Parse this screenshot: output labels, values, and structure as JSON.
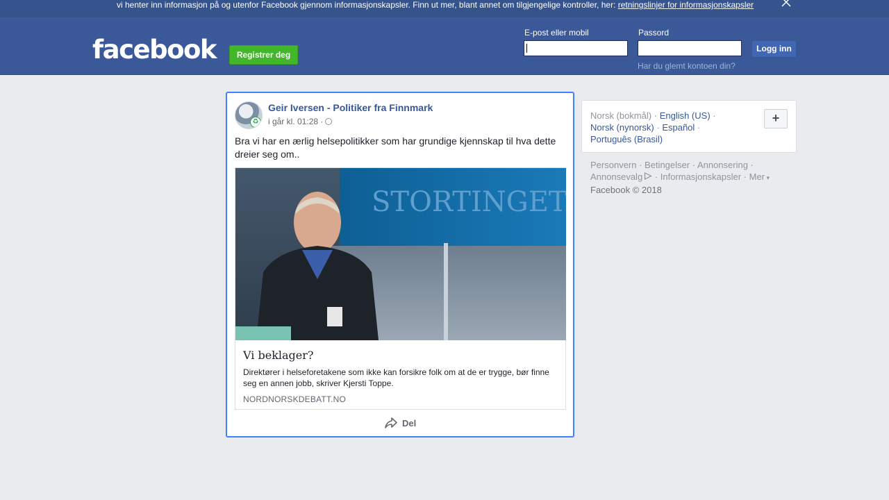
{
  "cookie_bar": {
    "text": "vi henter inn informasjon på og utenfor Facebook gjennom informasjonskapsler. Finn ut mer, blant annet om tilgjengelige kontroller, her: ",
    "link": "retningslinjer for informasjonskapsler"
  },
  "header": {
    "logo": "facebook",
    "register_label": "Registrer deg",
    "email_label": "E-post eller mobil",
    "email_value": "",
    "password_label": "Passord",
    "password_value": "",
    "login_label": "Logg inn",
    "forgot_label": "Har du glemt kontoen din?"
  },
  "post": {
    "author": "Geir Iversen - Politiker fra Finnmark",
    "timestamp": "i går kl. 01:28 ·",
    "text": "Bra vi har en ærlig helsepolitikker som har grundige kjennskap til hva dette dreier seg om..",
    "link": {
      "image_sign": "STORTINGET",
      "title": "Vi beklager?",
      "description": "Direktører i helseforetakene som ikke kan forsikre folk om at de er trygge, bør finne seg en annen jobb, skriver Kjersti Toppe.",
      "domain": "NORDNORSKDEBATT.NO"
    },
    "share_label": "Del"
  },
  "sidebar": {
    "languages": [
      {
        "label": "Norsk (bokmål)",
        "current": true
      },
      {
        "label": "English (US)",
        "current": false
      },
      {
        "label": "Norsk (nynorsk)",
        "current": false
      },
      {
        "label": "Español",
        "current": false
      },
      {
        "label": "Português (Brasil)",
        "current": false
      }
    ],
    "add_language_label": "+",
    "footer": {
      "links": [
        "Personvern",
        "Betingelser",
        "Annonsering",
        "Annonsevalg",
        "Informasjonskapsler",
        "Mer"
      ],
      "copyright": "Facebook © 2018"
    }
  },
  "colors": {
    "brand_blue": "#3b5998",
    "register_green": "#42b72a",
    "link_blue": "#365899",
    "focus_blue": "#4080ff"
  }
}
